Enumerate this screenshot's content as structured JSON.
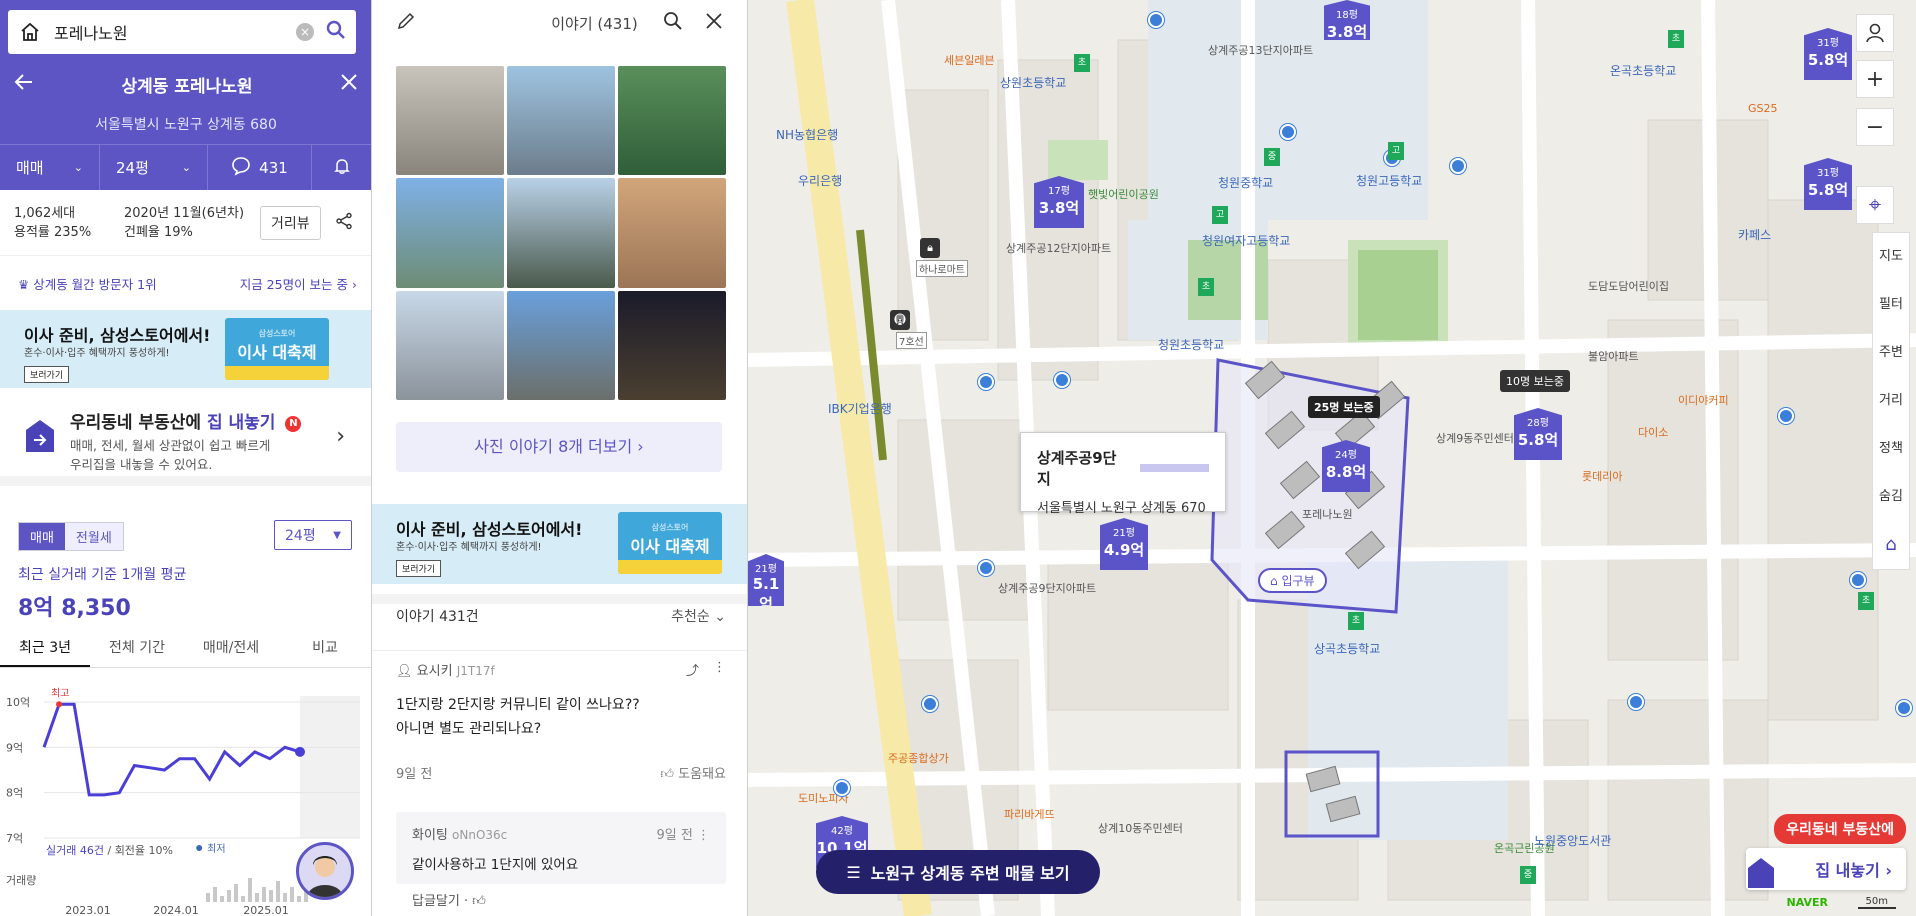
{
  "search": {
    "query": "포레나노원"
  },
  "complex": {
    "title": "상계동 포레나노원",
    "address": "서울특별시 노원구 상계동 680",
    "tab_trade": "매매",
    "tab_size": "24평",
    "talk_count": "431",
    "households": "1,062세대",
    "far": "용적률 235%",
    "built": "2020년 11월(6년차)",
    "bcr": "건폐율 19%",
    "street_view": "거리뷰"
  },
  "rank": {
    "left": "상계동 월간 방문자 1위",
    "right": "지금 25명이 보는 중 ›"
  },
  "banner": {
    "title": "이사 준비, 삼성스토어에서!",
    "sub": "혼수·이사·입주 혜택까지 풍성하게!",
    "btn": "보러가기",
    "img_small": "삼성스토어",
    "img_big": "이사 대축제"
  },
  "listing": {
    "title_pre": "우리동네 부동산에 ",
    "title_hl": "집 내놓기",
    "badge": "N",
    "desc1": "매매, 전세, 월세 상관없이 쉽고 빠르게",
    "desc2": "우리집을 내놓을 수 있어요."
  },
  "price": {
    "seg_trade": "매매",
    "seg_rent": "전월세",
    "size": "24평",
    "caption": "최근 실거래 기준 1개월 평균",
    "value": "8억 8,350",
    "tabs": [
      "최근 3년",
      "전체 기간",
      "매매/전세",
      "비교"
    ]
  },
  "chart_data": {
    "type": "line",
    "title": "",
    "xlabel": "",
    "ylabel": "",
    "y_ticks": [
      "10억",
      "9억",
      "8억",
      "7억"
    ],
    "ylim": [
      7,
      10
    ],
    "x_ticks": [
      "2023.01",
      "2024.01",
      "2025.01"
    ],
    "annot_high": "최고",
    "annot_low": "최저",
    "footer_count": "실거래 46건",
    "footer_sep": " / ",
    "footer_rate": "회전율 10%",
    "volume_label": "거래량",
    "series": [
      {
        "x": [
          0,
          2,
          4,
          6,
          8,
          10,
          12,
          14,
          16,
          18,
          20,
          22,
          24,
          26,
          28,
          30,
          32,
          34
        ],
        "values": [
          9.0,
          9.95,
          9.95,
          7.95,
          7.95,
          8.0,
          8.6,
          8.55,
          8.5,
          8.75,
          8.75,
          8.3,
          8.9,
          8.6,
          8.9,
          8.75,
          9.0,
          8.9
        ]
      }
    ]
  },
  "story": {
    "header": "이야기 (431)",
    "more_photos": "사진 이야기 8개 더보기 ›",
    "count": "이야기 431건",
    "sort": "추천순",
    "post": {
      "author": "요시키",
      "id": "J1T17f",
      "line1": "1단지랑 2단지랑 커뮤니티 같이 쓰나요??",
      "line2": "아니면 별도 관리되나요?",
      "time": "9일 전",
      "helpful": "도움돼요"
    },
    "reply": {
      "author": "화이팅",
      "id": "oNnO36c",
      "time": "9일 전",
      "text": "같이사용하고 1단지에 있어요",
      "btn": "답글달기"
    }
  },
  "map": {
    "popup_title": "상계주공9단지",
    "popup_addr": "서울특별시 노원구 상계동 670",
    "bottom_btn": "노원구 상계동 주변 매물 보기",
    "sell_btn": "우리동네 부동산에",
    "sell_btn2": "집 내놓기 ›",
    "watch25": "25명 보는중",
    "watch10": "10명 보는중",
    "entrance": "입구뷰",
    "rail": [
      "지도",
      "필터",
      "주변",
      "거리",
      "정책",
      "숨김"
    ],
    "naver": "NAVER",
    "scale": "50m",
    "pins": [
      {
        "size": "18평",
        "price": "3.8억"
      },
      {
        "size": "17평",
        "price": "3.8억"
      },
      {
        "size": "31평",
        "price": "5.8억"
      },
      {
        "size": "31평",
        "price": "5.8억"
      },
      {
        "size": "24평",
        "price": "8.8억"
      },
      {
        "size": "28평",
        "price": "5.8억"
      },
      {
        "size": "21평",
        "price": "4.9억"
      },
      {
        "size": "21평",
        "price": "5.1억"
      },
      {
        "size": "42평",
        "price": "10.1억"
      }
    ],
    "labels": [
      "상계주공13단지아파트",
      "상계주공12단지아파트",
      "상계주공9단지아파트",
      "포레나노원",
      "청원중학교",
      "청원고등학교",
      "청원여자고등학교",
      "청원초등학교",
      "상곡초등학교",
      "상원초등학교",
      "온곡초등학교",
      "햇빛어린이공원",
      "도담도담어린이집",
      "불암아파트",
      "상계9동주민센터",
      "주공종합상가",
      "파리바게뜨",
      "하나로마트",
      "7호선",
      "세븐일레븐",
      "NH농협은행",
      "우리은행",
      "IBK기업은행",
      "다이소",
      "롯데리아",
      "GS25",
      "카페스",
      "이디야커피",
      "상계10동주민센터",
      "온곡근린공원",
      "노원중앙도서관",
      "도미노피자"
    ]
  }
}
